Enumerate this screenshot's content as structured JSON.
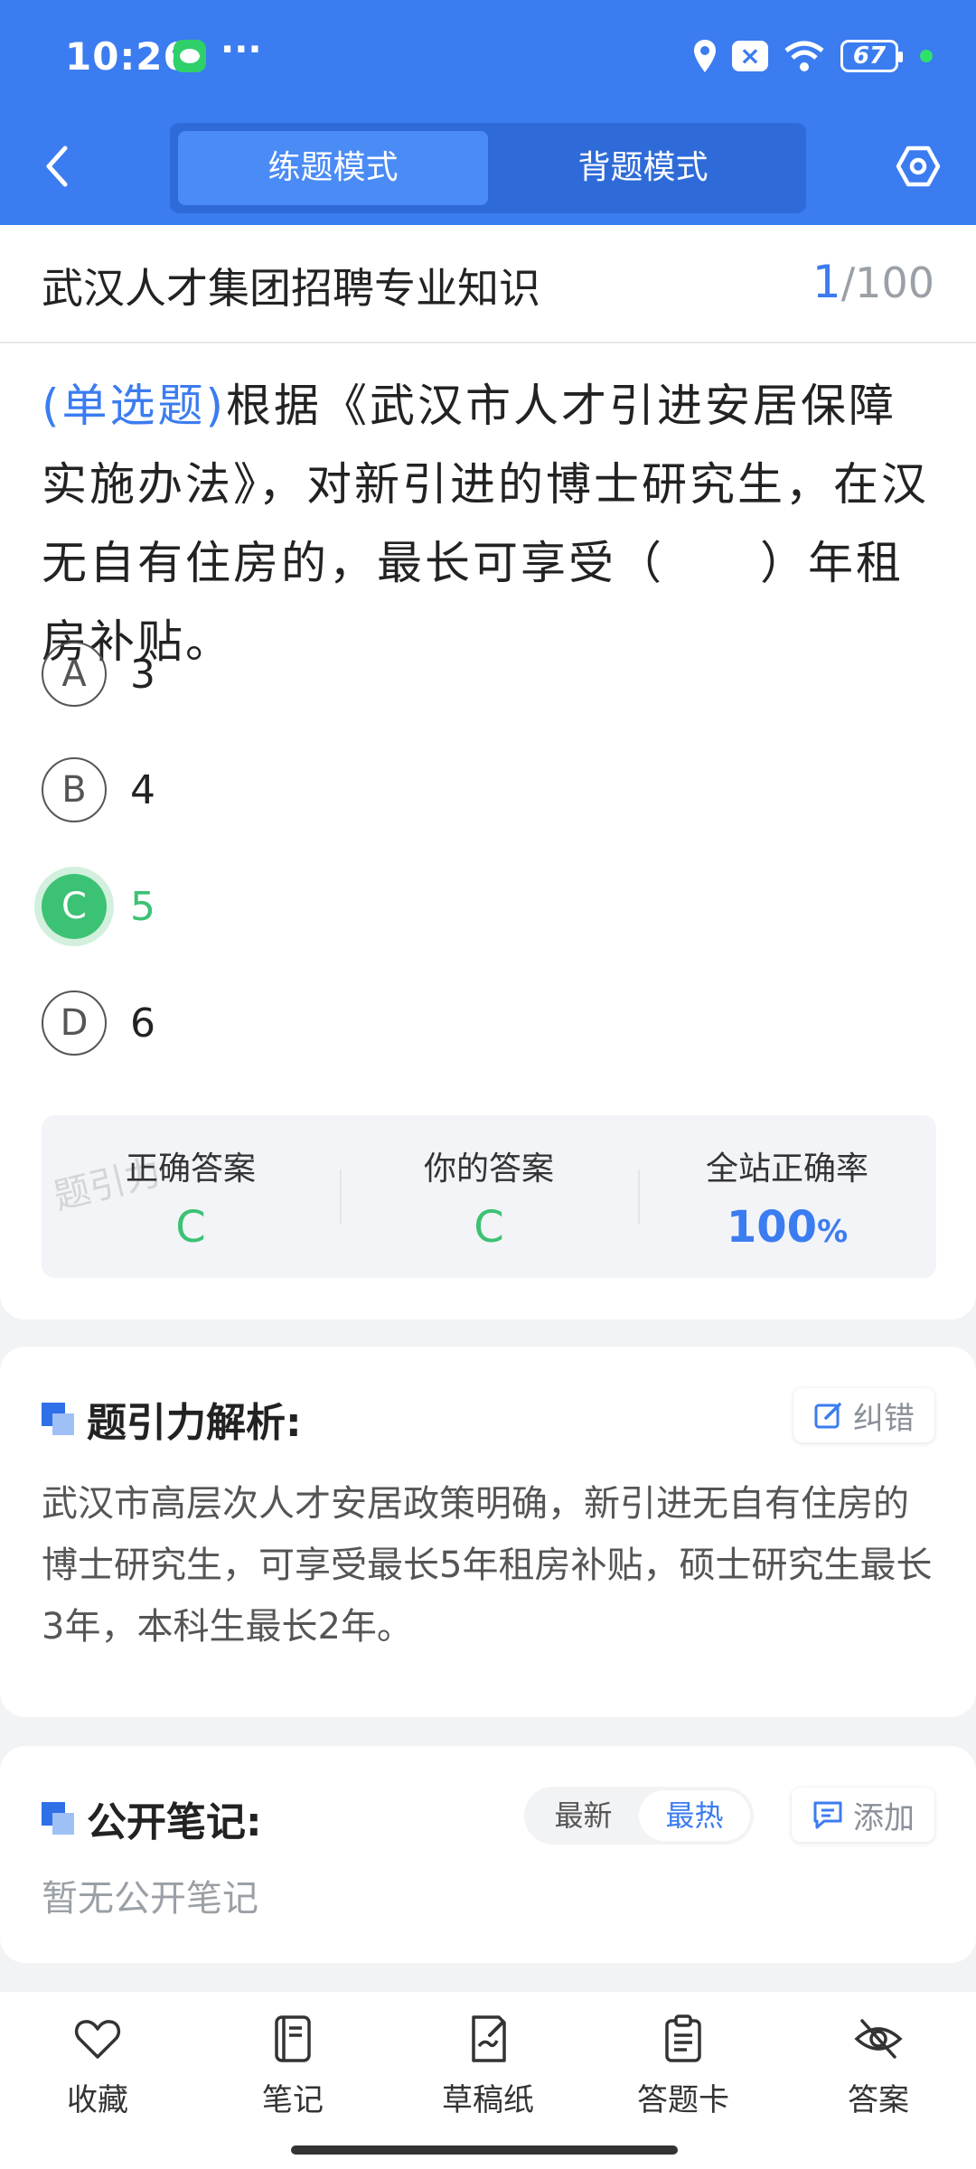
{
  "status": {
    "time": "10:26",
    "battery": "67"
  },
  "header": {
    "modes": [
      "练题模式",
      "背题模式"
    ]
  },
  "titlebar": {
    "subject": "武汉人才集团招聘专业知识",
    "current": "1",
    "total": "/100"
  },
  "question": {
    "type": "(单选题)",
    "text": "根据《武汉市人才引进安居保障实施办法》，对新引进的博士研究生，在汉无自有住房的，最长可享受（　　）年租房补贴。",
    "options": [
      {
        "letter": "A",
        "text": "3"
      },
      {
        "letter": "B",
        "text": "4"
      },
      {
        "letter": "C",
        "text": "5"
      },
      {
        "letter": "D",
        "text": "6"
      }
    ]
  },
  "answers": {
    "correct_label": "正确答案",
    "correct_value": "C",
    "yours_label": "你的答案",
    "yours_value": "C",
    "rate_label": "全站正确率",
    "rate_value": "100",
    "rate_unit": "%",
    "watermark": "题引力"
  },
  "analysis": {
    "title": "题引力解析:",
    "report_label": "纠错",
    "text": "武汉市高层次人才安居政策明确，新引进无自有住房的博士研究生，可享受最长5年租房补贴，硕士研究生最长3年，本科生最长2年。"
  },
  "notes": {
    "title": "公开笔记:",
    "sort": [
      "最新",
      "最热"
    ],
    "add_label": "添加",
    "empty": "暂无公开笔记"
  },
  "bottom": {
    "tabs": [
      {
        "label": "收藏",
        "icon": "heart-icon"
      },
      {
        "label": "笔记",
        "icon": "notebook-icon"
      },
      {
        "label": "草稿纸",
        "icon": "draft-icon"
      },
      {
        "label": "答题卡",
        "icon": "clipboard-icon"
      },
      {
        "label": "答案",
        "icon": "eye-off-icon"
      }
    ]
  },
  "colors": {
    "brand": "#3b7cf0",
    "correct": "#3cc274"
  }
}
